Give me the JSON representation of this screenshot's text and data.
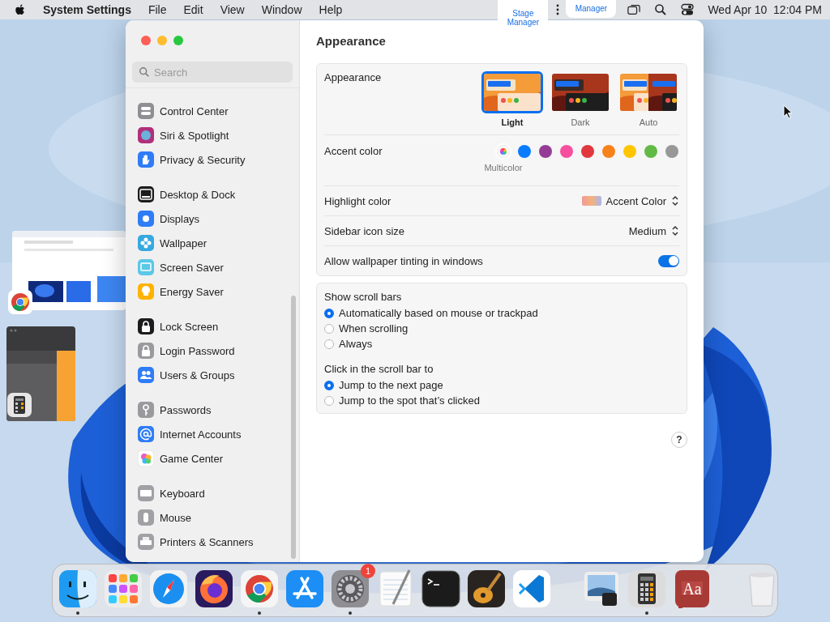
{
  "menu_bar": {
    "app": "System Settings",
    "menus": [
      "File",
      "Edit",
      "View",
      "Window",
      "Help"
    ],
    "stage_manager": [
      "Stage Manager",
      "Manager"
    ],
    "clock": "Wed Apr 10  12:04 PM"
  },
  "window": {
    "search": {
      "placeholder": "Search"
    },
    "sidebar": {
      "groups": [
        [
          {
            "label": "Control Center",
            "kind": "control"
          },
          {
            "label": "Siri & Spotlight",
            "kind": "siri"
          },
          {
            "label": "Privacy & Security",
            "kind": "privacy"
          }
        ],
        [
          {
            "label": "Desktop & Dock",
            "kind": "dock"
          },
          {
            "label": "Displays",
            "kind": "displays"
          },
          {
            "label": "Wallpaper",
            "kind": "wallpaper"
          },
          {
            "label": "Screen Saver",
            "kind": "screensaver"
          },
          {
            "label": "Energy Saver",
            "kind": "energy"
          }
        ],
        [
          {
            "label": "Lock Screen",
            "kind": "lock"
          },
          {
            "label": "Login Password",
            "kind": "login"
          },
          {
            "label": "Users & Groups",
            "kind": "users"
          }
        ],
        [
          {
            "label": "Passwords",
            "kind": "key"
          },
          {
            "label": "Internet Accounts",
            "kind": "at"
          },
          {
            "label": "Game Center",
            "kind": "game"
          }
        ],
        [
          {
            "label": "Keyboard",
            "kind": "keyboard"
          },
          {
            "label": "Mouse",
            "kind": "mouse"
          },
          {
            "label": "Printers & Scanners",
            "kind": "printer"
          }
        ]
      ]
    },
    "title": "Appearance",
    "appearance": {
      "label": "Appearance",
      "options": [
        {
          "label": "Light",
          "kind": "light",
          "selected": true
        },
        {
          "label": "Dark",
          "kind": "dark",
          "selected": false
        },
        {
          "label": "Auto",
          "kind": "auto",
          "selected": false
        }
      ]
    },
    "accent": {
      "label": "Accent color",
      "selected_label": "Multicolor",
      "colors": [
        {
          "kind": "multicolor",
          "selected": true
        },
        {
          "kind": "solid",
          "color": "#0a7cff",
          "selected": false
        },
        {
          "kind": "solid",
          "color": "#953d96",
          "selected": false
        },
        {
          "kind": "solid",
          "color": "#f74f9e",
          "selected": false
        },
        {
          "kind": "solid",
          "color": "#e0383e",
          "selected": false
        },
        {
          "kind": "solid",
          "color": "#f7821b",
          "selected": false
        },
        {
          "kind": "solid",
          "color": "#ffc600",
          "selected": false
        },
        {
          "kind": "solid",
          "color": "#62ba46",
          "selected": false
        },
        {
          "kind": "solid",
          "color": "#989898",
          "selected": false
        }
      ]
    },
    "highlight": {
      "label": "Highlight color",
      "value": "Accent Color"
    },
    "icon_size": {
      "label": "Sidebar icon size",
      "value": "Medium"
    },
    "tinting": {
      "label": "Allow wallpaper tinting in windows",
      "on": true
    },
    "scroll_groups": [
      {
        "label": "Show scroll bars",
        "options": [
          {
            "label": "Automatically based on mouse or trackpad",
            "selected": true
          },
          {
            "label": "When scrolling",
            "selected": false
          },
          {
            "label": "Always",
            "selected": false
          }
        ]
      },
      {
        "label": "Click in the scroll bar to",
        "options": [
          {
            "label": "Jump to the next page",
            "selected": true
          },
          {
            "label": "Jump to the spot that’s clicked",
            "selected": false
          }
        ]
      }
    ],
    "help": "?"
  },
  "dock": {
    "sections": [
      [
        {
          "kind": "finder",
          "running": true
        },
        {
          "kind": "launchpad",
          "running": false
        },
        {
          "kind": "safari",
          "running": false
        },
        {
          "kind": "firefox",
          "running": false
        },
        {
          "kind": "chrome",
          "running": true
        },
        {
          "kind": "appstore",
          "running": false
        },
        {
          "kind": "settings",
          "running": true,
          "badge": "1"
        },
        {
          "kind": "textedit",
          "running": false
        },
        {
          "kind": "terminal",
          "running": false
        },
        {
          "kind": "garageband",
          "running": false
        },
        {
          "kind": "vscode",
          "running": false
        }
      ],
      [
        {
          "kind": "preview",
          "running": false
        },
        {
          "kind": "calculator",
          "running": true
        },
        {
          "kind": "dictionary",
          "running": false,
          "letters": "Aa"
        }
      ],
      [
        {
          "kind": "trash",
          "running": false
        }
      ]
    ]
  }
}
